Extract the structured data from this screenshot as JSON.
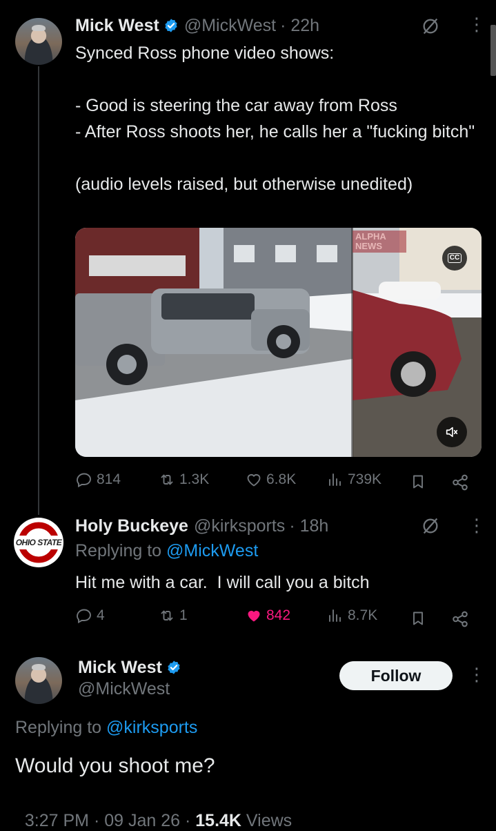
{
  "tweet1": {
    "author_name": "Mick West",
    "author_handle": "@MickWest",
    "time": "· 22h",
    "body": "Synced Ross phone video shows:\n\n- Good is steering the car away from Ross\n- After Ross shoots her, he calls her a \"fucking bitch\"\n\n(audio levels raised, but otherwise unedited)",
    "media": {
      "overlay_text": "ALPHA NEWS",
      "cc_label": "CC"
    },
    "actions": {
      "replies": "814",
      "reposts": "1.3K",
      "likes": "6.8K",
      "views": "739K"
    }
  },
  "tweet2": {
    "author_name": "Holy Buckeye",
    "author_handle": "@kirksports",
    "time": "· 18h",
    "replying_prefix": "Replying to",
    "replying_to": "@MickWest",
    "body": "Hit me with a car.  I will call you a bitch",
    "avatar_text": "OHIO STATE",
    "actions": {
      "replies": "4",
      "reposts": "1",
      "likes": "842",
      "views": "8.7K"
    }
  },
  "tweet3": {
    "author_name": "Mick West",
    "author_handle": "@MickWest",
    "follow_label": "Follow",
    "replying_prefix": "Replying to",
    "replying_to": "@kirksports",
    "body": "Would you shoot me?",
    "timestamp": "3:27 PM · 09 Jan 26 · ",
    "views_count": "15.4K",
    "views_label": " Views"
  },
  "colors": {
    "background": "#000000",
    "text": "#e7e9ea",
    "secondary": "#71767b",
    "accent": "#1d9bf0",
    "like_active": "#f91880"
  },
  "icons": [
    "verified-badge-icon",
    "grok-icon",
    "more-icon",
    "reply-icon",
    "repost-icon",
    "like-icon",
    "views-icon",
    "bookmark-icon",
    "share-icon",
    "cc-icon",
    "mute-icon"
  ]
}
